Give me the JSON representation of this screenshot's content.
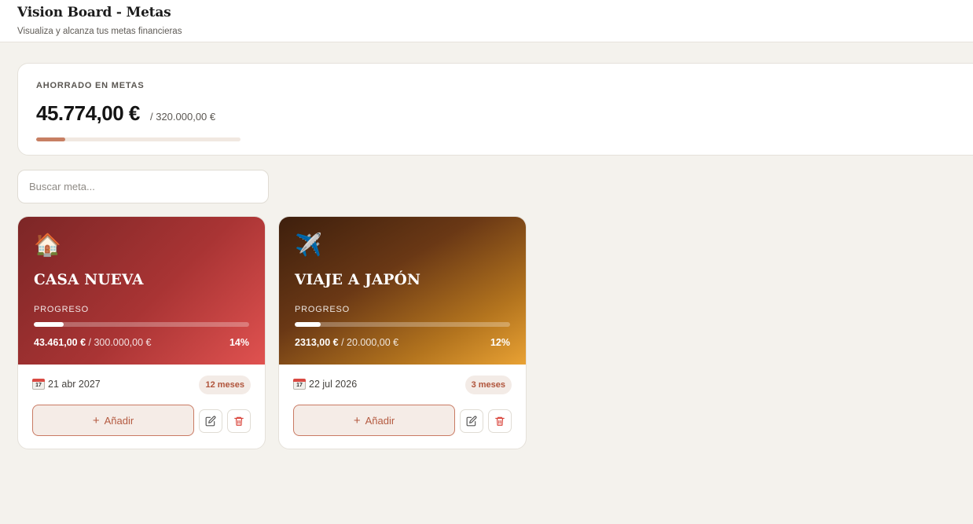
{
  "header": {
    "title": "Vision Board - Metas",
    "subtitle": "Visualiza y alcanza tus metas financieras"
  },
  "summary": {
    "label": "AHORRADO EN METAS",
    "amount": "45.774,00 €",
    "total": "/ 320.000,00 €",
    "progress_fraction": 0.143,
    "accent_color": "#c77f63"
  },
  "search": {
    "placeholder": "Buscar meta...",
    "value": ""
  },
  "goals": [
    {
      "icon": "house-icon",
      "emoji": "🏠",
      "title": "CASA NUEVA",
      "progress_label": "PROGRESO",
      "saved": "43.461,00 €",
      "goal": "/ 300.000,00 €",
      "percent": "14%",
      "progress_fraction": 0.14,
      "date": "21 abr 2027",
      "badge": "12 meses",
      "add_label": "Añadir",
      "theme": "red"
    },
    {
      "icon": "airplane-icon",
      "emoji": "✈️",
      "title": "VIAJE A JAPÓN",
      "progress_label": "PROGRESO",
      "saved": "2313,00 €",
      "goal": "/ 20.000,00 €",
      "percent": "12%",
      "progress_fraction": 0.12,
      "date": "22 jul 2026",
      "badge": "3 meses",
      "add_label": "Añadir",
      "theme": "gold"
    }
  ],
  "colors": {
    "background": "#f4f2ed",
    "badge_text": "#b0543b",
    "delete_icon": "#d9453c"
  }
}
